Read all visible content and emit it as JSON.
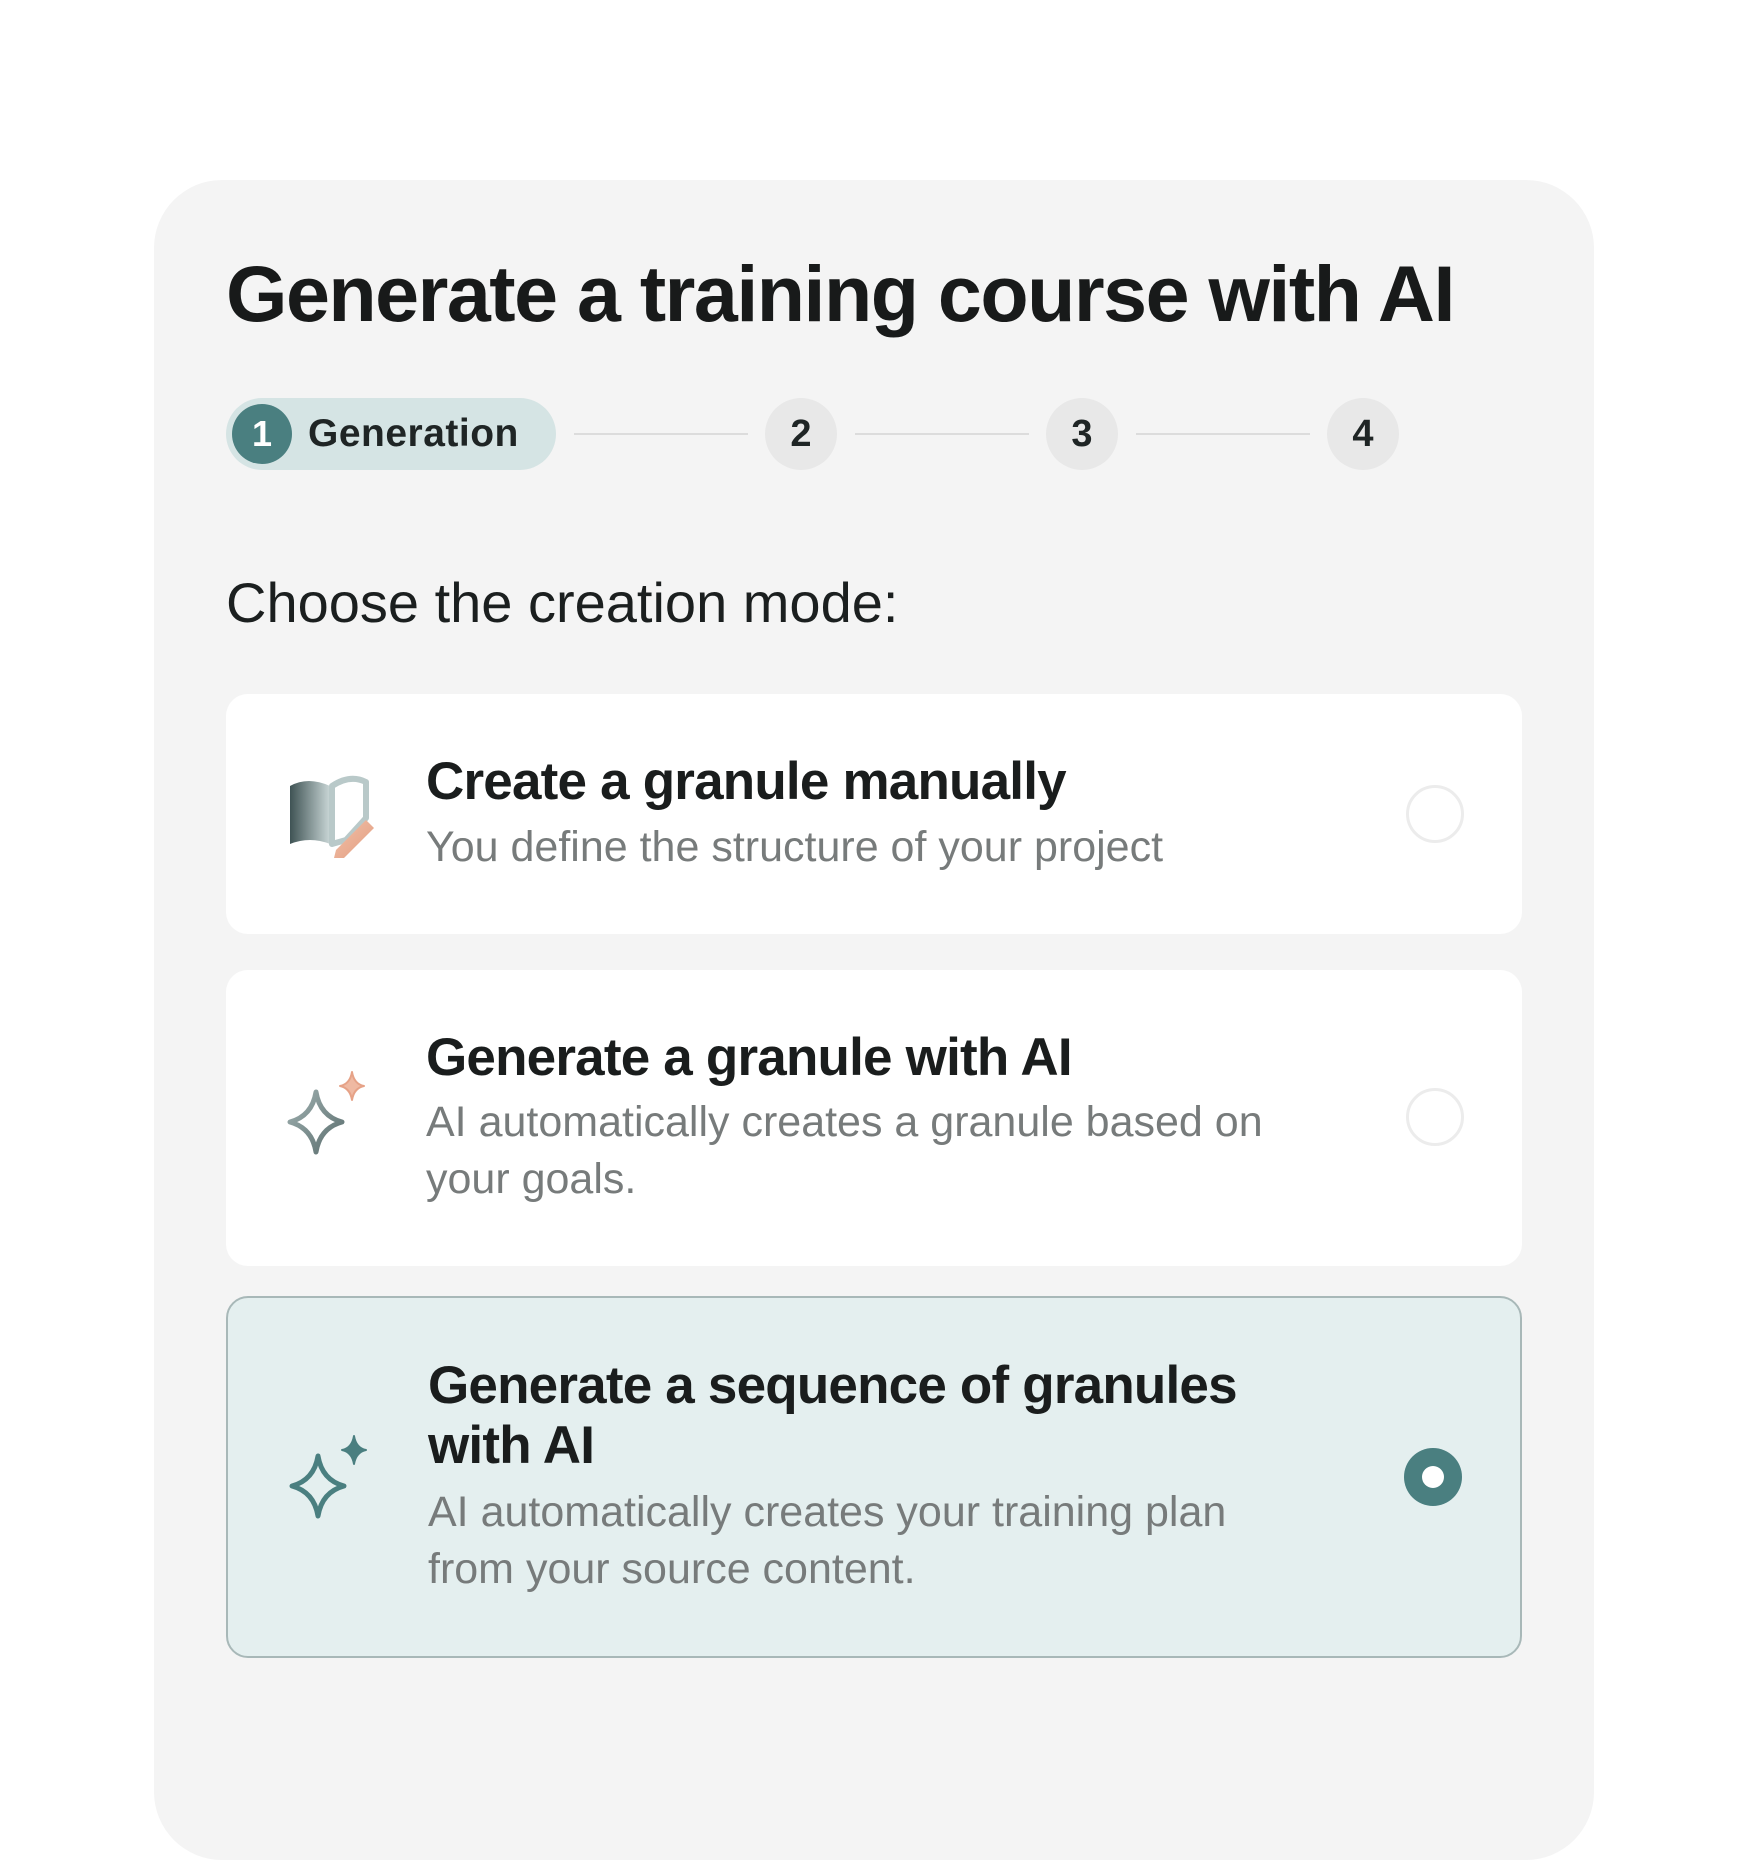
{
  "page": {
    "title": "Generate a training course with AI"
  },
  "stepper": {
    "steps": [
      {
        "number": "1",
        "label": "Generation",
        "active": true
      },
      {
        "number": "2",
        "label": "",
        "active": false
      },
      {
        "number": "3",
        "label": "",
        "active": false
      },
      {
        "number": "4",
        "label": "",
        "active": false
      }
    ]
  },
  "prompt": "Choose the creation mode:",
  "options": [
    {
      "title": "Create a granule manually",
      "description": "You define the structure of your project",
      "icon": "book-pencil-icon",
      "selected": false
    },
    {
      "title": "Generate a granule with AI",
      "description": "AI automatically creates a granule based on your goals.",
      "icon": "sparkle-icon",
      "selected": false
    },
    {
      "title": "Generate a sequence of granules with AI",
      "description": "AI automatically creates your training plan from your source content.",
      "icon": "sparkle-icon",
      "selected": true
    }
  ],
  "colors": {
    "accent": "#4a7f80",
    "accent_light": "#d5e4e4",
    "selected_bg": "#e4efef",
    "card_bg": "#f4f4f4",
    "sparkle_secondary": "#e8a88f"
  }
}
